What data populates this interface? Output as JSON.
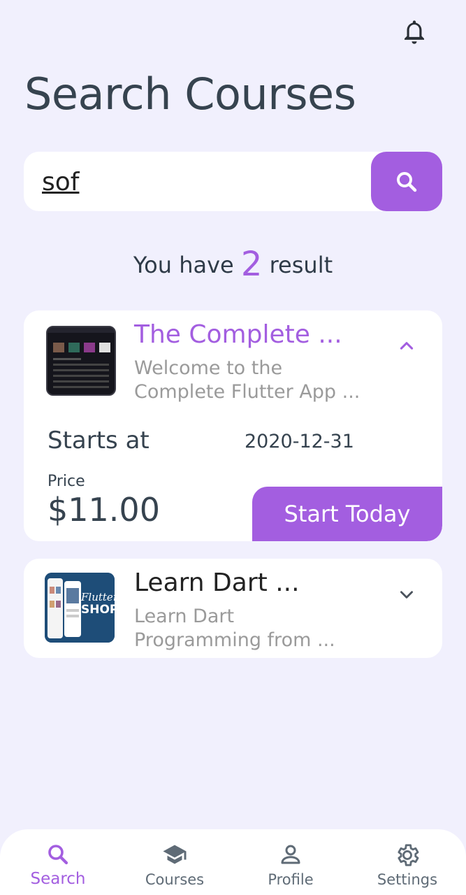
{
  "header": {
    "title": "Search Courses"
  },
  "search": {
    "value": "sof"
  },
  "results": {
    "prefix": "You have",
    "count": "2",
    "suffix": "result"
  },
  "courses": [
    {
      "title": "The Complete ...",
      "description_line1": "Welcome to the",
      "description_line2": "Complete Flutter App ...",
      "starts_label": "Starts at",
      "starts_date": "2020-12-31",
      "price_label": "Price",
      "price": "$11.00",
      "cta": "Start Today",
      "expanded": true
    },
    {
      "title": "Learn Dart ...",
      "description_line1": "Learn Dart",
      "description_line2": "Programming from ...",
      "expanded": false
    }
  ],
  "nav": [
    {
      "label": "Search",
      "icon": "search-icon",
      "active": true
    },
    {
      "label": "Courses",
      "icon": "graduation-cap-icon",
      "active": false
    },
    {
      "label": "Profile",
      "icon": "person-icon",
      "active": false
    },
    {
      "label": "Settings",
      "icon": "gear-icon",
      "active": false
    }
  ],
  "colors": {
    "accent": "#a35ee0",
    "background": "#f1f0fd",
    "card": "#ffffff",
    "text": "#36434f",
    "muted": "#9a9a9a"
  }
}
